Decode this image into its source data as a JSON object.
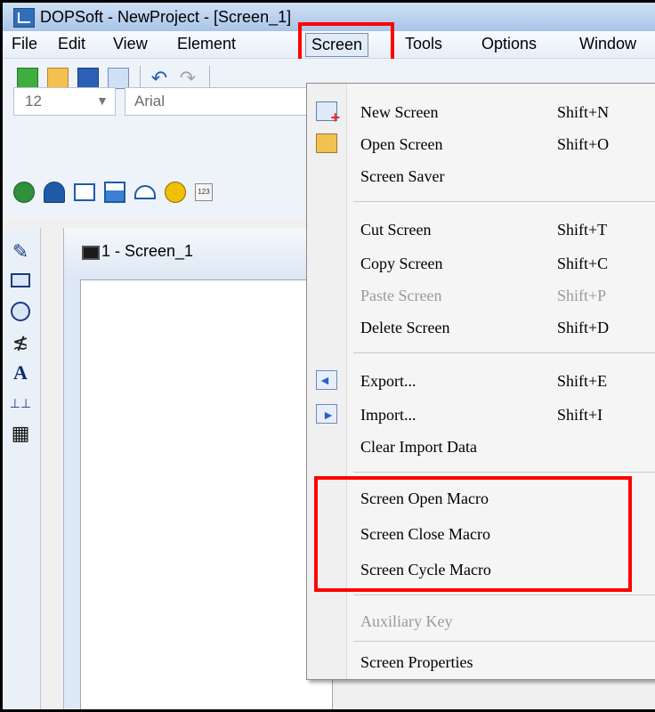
{
  "window": {
    "title": "DOPSoft - NewProject - [Screen_1]"
  },
  "menubar": {
    "items": [
      "File",
      "Edit",
      "View",
      "Element",
      "Screen",
      "Tools",
      "Options",
      "Window"
    ]
  },
  "toolbar": {
    "font_size": "12",
    "font_name": "Arial"
  },
  "document_tab": {
    "label": "1 - Screen_1"
  },
  "screen_menu": {
    "new_screen": {
      "label": "New Screen",
      "shortcut": "Shift+N"
    },
    "open_screen": {
      "label": "Open Screen",
      "shortcut": "Shift+O"
    },
    "screen_saver": {
      "label": "Screen Saver"
    },
    "cut_screen": {
      "label": "Cut Screen",
      "shortcut": "Shift+T"
    },
    "copy_screen": {
      "label": "Copy Screen",
      "shortcut": "Shift+C"
    },
    "paste_screen": {
      "label": "Paste Screen",
      "shortcut": "Shift+P"
    },
    "delete_screen": {
      "label": "Delete Screen",
      "shortcut": "Shift+D"
    },
    "export": {
      "label": "Export...",
      "shortcut": "Shift+E"
    },
    "import": {
      "label": "Import...",
      "shortcut": "Shift+I"
    },
    "clear_import": {
      "label": "Clear Import Data"
    },
    "open_macro": {
      "label": "Screen Open Macro"
    },
    "close_macro": {
      "label": "Screen Close Macro"
    },
    "cycle_macro": {
      "label": "Screen Cycle Macro"
    },
    "aux_key": {
      "label": "Auxiliary Key"
    },
    "properties": {
      "label": "Screen Properties"
    }
  },
  "colors": {
    "highlight": "#ff0000",
    "menu_bg": "#f5f5f5",
    "disabled_text": "#9a9a9a"
  }
}
